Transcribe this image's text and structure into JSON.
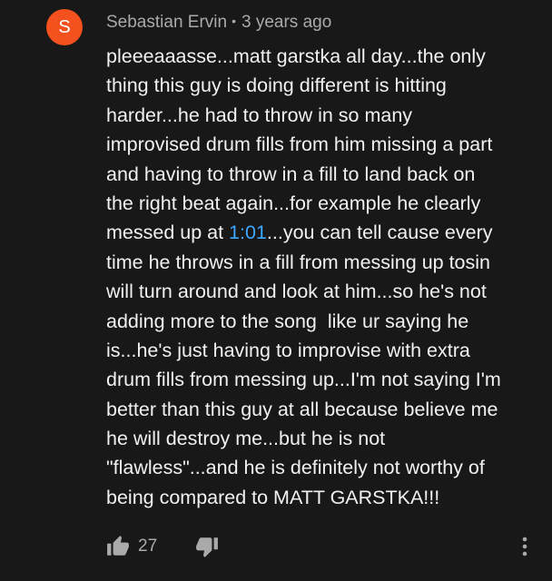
{
  "comment": {
    "avatar_letter": "S",
    "author": "Sebastian Ervin",
    "separator": "•",
    "time": "3 years ago",
    "lines": [
      "pleeeaaasse...matt garstka all day...the only",
      "thing this guy is doing different is hitting",
      "harder...he had to throw in so many",
      "improvised drum fills from him missing a part",
      "and having to throw in a fill to land back on",
      "the right beat again...for example he clearly"
    ],
    "line7_before": "messed up at ",
    "timestamp_link": "1:01",
    "line7_after": "...you can tell cause every",
    "lines_after": [
      "time he throws in a fill from messing up tosin",
      "will turn around and look at him...so he's not",
      "adding more to the song  like ur saying he",
      "is...he's just having to improvise with extra",
      "drum fills from messing up...I'm not saying I'm",
      "better than this guy at all because believe me",
      "he will destroy me...but he is not",
      "\"flawless\"...and he is definitely not worthy of",
      "being compared to MATT GARSTKA!!!"
    ],
    "like_count": "27"
  },
  "colors": {
    "background": "#181818",
    "avatar": "#f4511e",
    "text": "#f1f1f1",
    "secondary_text": "#aaaaaa",
    "link": "#3ea6ff"
  },
  "icons": {
    "like": "thumbs-up-icon",
    "dislike": "thumbs-down-icon",
    "more": "more-vert-icon"
  }
}
